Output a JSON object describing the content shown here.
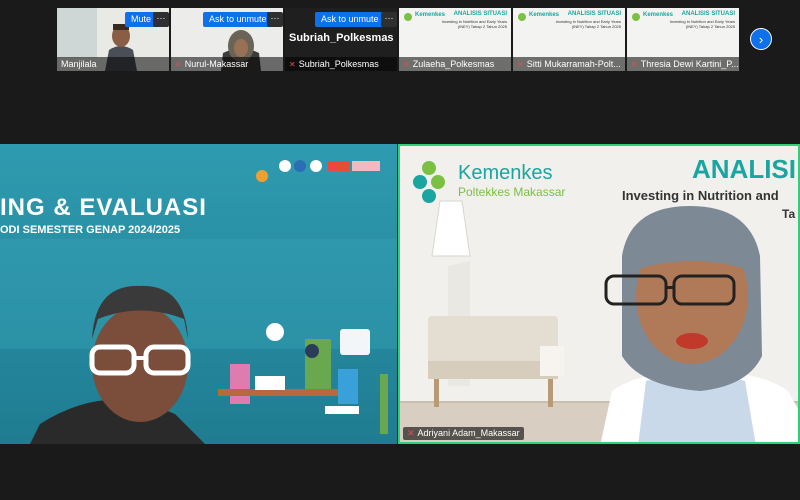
{
  "participants": [
    {
      "name": "Manjilala",
      "button": "Mute",
      "more": "···"
    },
    {
      "name": "Nurul-Makassar",
      "button": "Ask to unmute",
      "more": "···"
    },
    {
      "name": "Subriah_Polkesmas",
      "button": "Ask to unmute",
      "more": "···",
      "display_name": "Subriah_Polkesmas"
    },
    {
      "name": "Zulaeha_Polkesmas",
      "slide_brand": "Kemenkes",
      "slide_title": "ANALISIS SITUASI",
      "slide_sub": "Investing in Nutrition and Early Years (INEY) Tahap 2 Tahun 2025"
    },
    {
      "name": "Sitti Mukarramah-Polt...",
      "slide_brand": "Kemenkes",
      "slide_title": "ANALISIS SITUASI",
      "slide_sub": "Investing in Nutrition and Early Years (INEY) Tahap 2 Tahun 2025"
    },
    {
      "name": "Thresia Dewi Kartini_P...",
      "slide_brand": "Kemenkes",
      "slide_title": "ANALISIS SITUASI",
      "slide_sub": "Investing in Nutrition and Early Years (INEY) Tahap 2 Tahun 2025"
    }
  ],
  "next_page_icon": "›",
  "main_left": {
    "line1": "ING & EVALUASI",
    "line2": "ODI SEMESTER GENAP 2024/2025"
  },
  "main_right": {
    "brand": "Kemenkes",
    "brand_sub": "Poltekkes Makassar",
    "title": "ANALISI",
    "subtitle": "Investing in Nutrition and",
    "subtitle2": "Ta",
    "name": "Adriyani Adam_Makassar"
  },
  "colors": {
    "accent": "#0e71eb",
    "speaker_border": "#2fd07a",
    "kemenkes": "#1aa5a0"
  }
}
